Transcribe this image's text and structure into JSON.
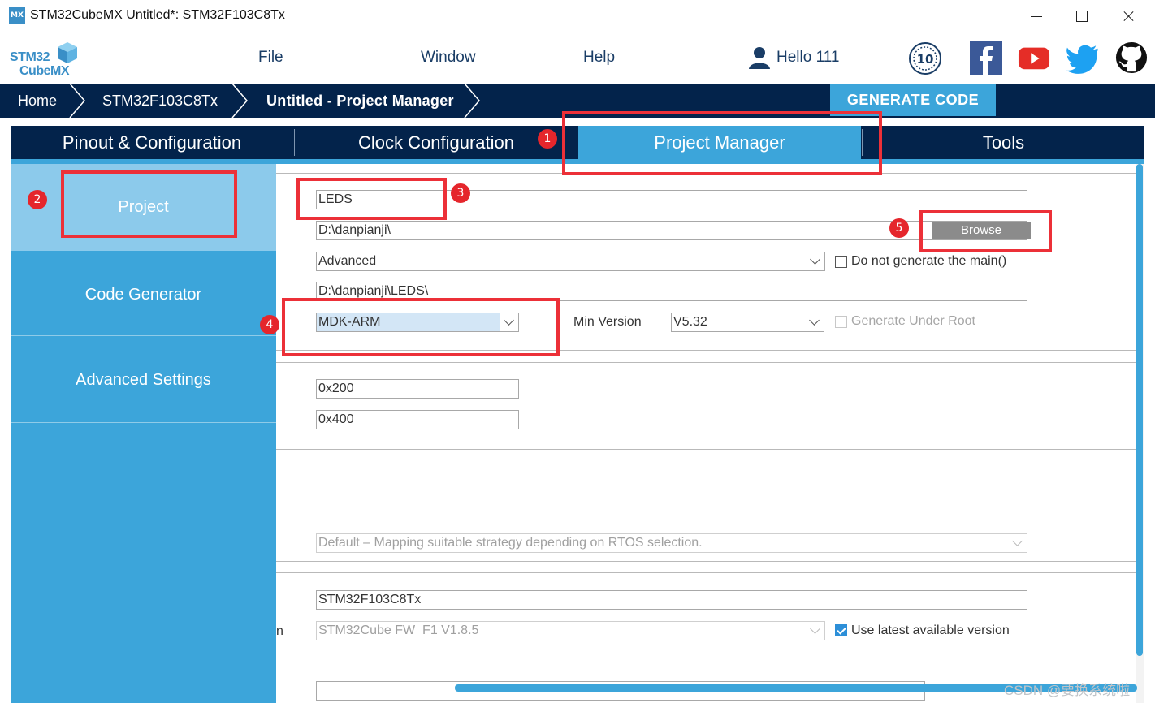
{
  "window": {
    "app_icon_label": "MX",
    "title": "STM32CubeMX Untitled*: STM32F103C8Tx"
  },
  "logo": {
    "line1": "STM32",
    "line2": "CubeMX"
  },
  "menu": {
    "items": [
      "File",
      "Window",
      "Help"
    ]
  },
  "user": {
    "greeting": "Hello 111"
  },
  "badge": {
    "label": "10"
  },
  "social": [
    "facebook",
    "youtube",
    "twitter",
    "github"
  ],
  "breadcrumb": {
    "items": [
      "Home",
      "STM32F103C8Tx",
      "Untitled - Project Manager"
    ]
  },
  "generate_code_label": "GENERATE CODE",
  "tabs": [
    {
      "label": "Pinout & Configuration",
      "active": false
    },
    {
      "label": "Clock Configuration",
      "active": false
    },
    {
      "label": "Project Manager",
      "active": true
    },
    {
      "label": "Tools",
      "active": false
    }
  ],
  "sidebar": {
    "items": [
      {
        "label": "Project",
        "active": true
      },
      {
        "label": "Code Generator",
        "active": false
      },
      {
        "label": "Advanced Settings",
        "active": false
      }
    ]
  },
  "project": {
    "name": "LEDS",
    "location": "D:\\danpianji\\",
    "browse_label": "Browse",
    "structure": "Advanced",
    "no_main_label": "Do not generate the main()",
    "no_main_checked": false,
    "toolchain_folder": "D:\\danpianji\\LEDS\\",
    "toolchain": "MDK-ARM",
    "min_version_label": "Min Version",
    "min_version": "V5.32",
    "gen_under_root_label": "Generate Under Root",
    "gen_under_root_checked": false,
    "heap_size": "0x200",
    "stack_size": "0x400",
    "thread_safe": "Default  –  Mapping suitable strategy depending on RTOS selection.",
    "mcu_reference": "STM32F103C8Tx",
    "firmware_package": "STM32Cube FW_F1 V1.8.5",
    "use_latest_label": "Use latest available version",
    "use_latest_checked": true,
    "clipped_label_fragment": "n"
  },
  "annotations": [
    "1",
    "2",
    "3",
    "4",
    "5"
  ],
  "watermark": "CSDN @要换系统啦",
  "colors": {
    "nav_dark": "#03234b",
    "accent_blue": "#3ca5da",
    "sidebar_active": "#8ccaeb",
    "annotation_red": "#ec3038"
  }
}
